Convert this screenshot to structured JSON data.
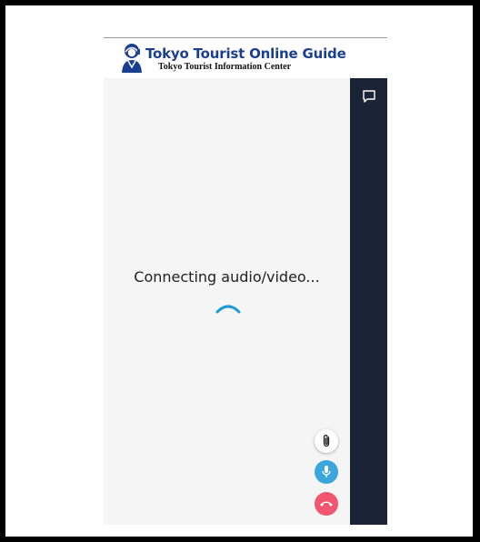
{
  "header": {
    "title": "Tokyo Tourist Online Guide",
    "subtitle": "Tokyo Tourist Information Center",
    "logo_icon": "guide-headset-logo",
    "brand_color": "#1b3f8f"
  },
  "call": {
    "status": "Connecting audio/video...",
    "spinner_color": "#1a9ad6",
    "background": "#f5f5f5"
  },
  "side_panel": {
    "background": "#1b2436",
    "chat_icon": "chat-bubble-icon"
  },
  "controls": {
    "attach_icon": "paperclip-icon",
    "mic_icon": "microphone-icon",
    "hangup_icon": "phone-hangup-icon",
    "mic_color": "#3aa6dc",
    "hangup_color": "#f2556f"
  }
}
